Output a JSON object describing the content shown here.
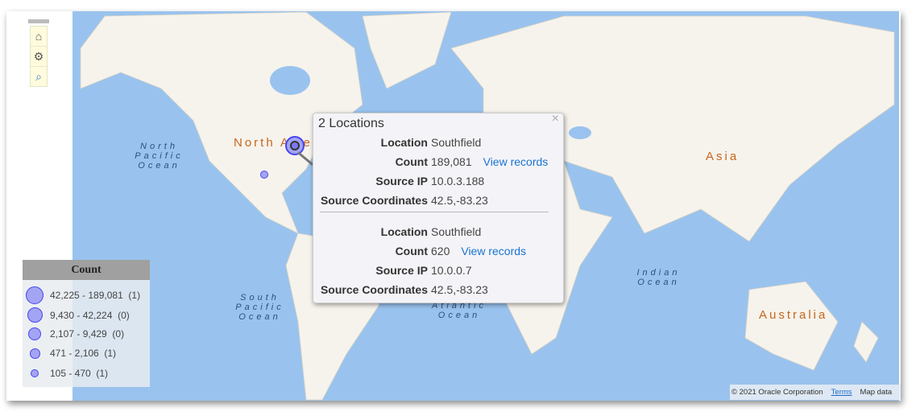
{
  "toolbar": {
    "items": [
      {
        "name": "home-icon",
        "glyph": "⌂"
      },
      {
        "name": "gear-icon",
        "glyph": "⚙"
      },
      {
        "name": "zoom-select-icon",
        "glyph": "🔍"
      }
    ]
  },
  "map": {
    "continent_labels": [
      "North America",
      "Asia",
      "Australia"
    ],
    "ocean_labels": {
      "north_pacific": "North Pacific Ocean",
      "south_pacific": "South Pacific Ocean",
      "indian": "Indian Ocean",
      "atlantic": "Atlantic Ocean"
    },
    "colors": {
      "water": "#99c3ee",
      "land": "#f6f3ec",
      "marker_fill": "#a4a4f4",
      "marker_stroke": "#4444f0"
    }
  },
  "legend": {
    "title": "Count",
    "items": [
      {
        "range": "42,225 - 189,081",
        "count": "(1)"
      },
      {
        "range": "9,430 - 42,224",
        "count": "(0)"
      },
      {
        "range": "2,107 - 9,429",
        "count": "(0)"
      },
      {
        "range": "471 - 2,106",
        "count": "(1)"
      },
      {
        "range": "105 - 470",
        "count": "(1)"
      }
    ]
  },
  "popup": {
    "title": "2 Locations",
    "close": "×",
    "view_label": "View records",
    "records": [
      {
        "location_label": "Location",
        "location": "Southfield",
        "count_label": "Count",
        "count": "189,081",
        "ip_label": "Source IP",
        "ip": "10.0.3.188",
        "coords_label": "Source Coordinates",
        "coords": "42.5,-83.23"
      },
      {
        "location_label": "Location",
        "location": "Southfield",
        "count_label": "Count",
        "count": "620",
        "ip_label": "Source IP",
        "ip": "10.0.0.7",
        "coords_label": "Source Coordinates",
        "coords": "42.5,-83.23"
      }
    ]
  },
  "attribution": {
    "copyright": "© 2021 Oracle Corporation",
    "terms": "Terms",
    "map_data": "Map data"
  }
}
